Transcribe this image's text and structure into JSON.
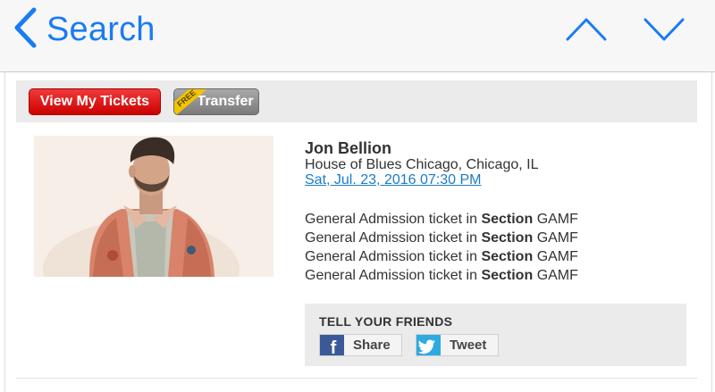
{
  "nav": {
    "back_label": "Search"
  },
  "actions": {
    "view_tickets_label": "View My Tickets",
    "transfer_label": "Transfer",
    "free_badge": "FREE"
  },
  "event": {
    "artist": "Jon Bellion",
    "venue": "House of Blues Chicago, Chicago, IL",
    "date": "Sat, Jul. 23, 2016 07:30 PM"
  },
  "tickets": [
    {
      "prefix": "General Admission ticket in",
      "section_label": "Section",
      "section": "GAMF"
    },
    {
      "prefix": "General Admission ticket in",
      "section_label": "Section",
      "section": "GAMF"
    },
    {
      "prefix": "General Admission ticket in",
      "section_label": "Section",
      "section": "GAMF"
    },
    {
      "prefix": "General Admission ticket in",
      "section_label": "Section",
      "section": "GAMF"
    }
  ],
  "social": {
    "title": "TELL YOUR FRIENDS",
    "facebook_label": "Share",
    "twitter_label": "Tweet"
  },
  "colors": {
    "ios_blue": "#1a7cf2",
    "primary_red": "#cc0000",
    "link_blue": "#1a7cc9",
    "facebook": "#3b5998",
    "twitter": "#2daae1"
  },
  "icons": {
    "back": "chevron-left-icon",
    "up": "chevron-up-icon",
    "down": "chevron-down-icon",
    "facebook": "facebook-icon",
    "twitter": "twitter-icon"
  }
}
